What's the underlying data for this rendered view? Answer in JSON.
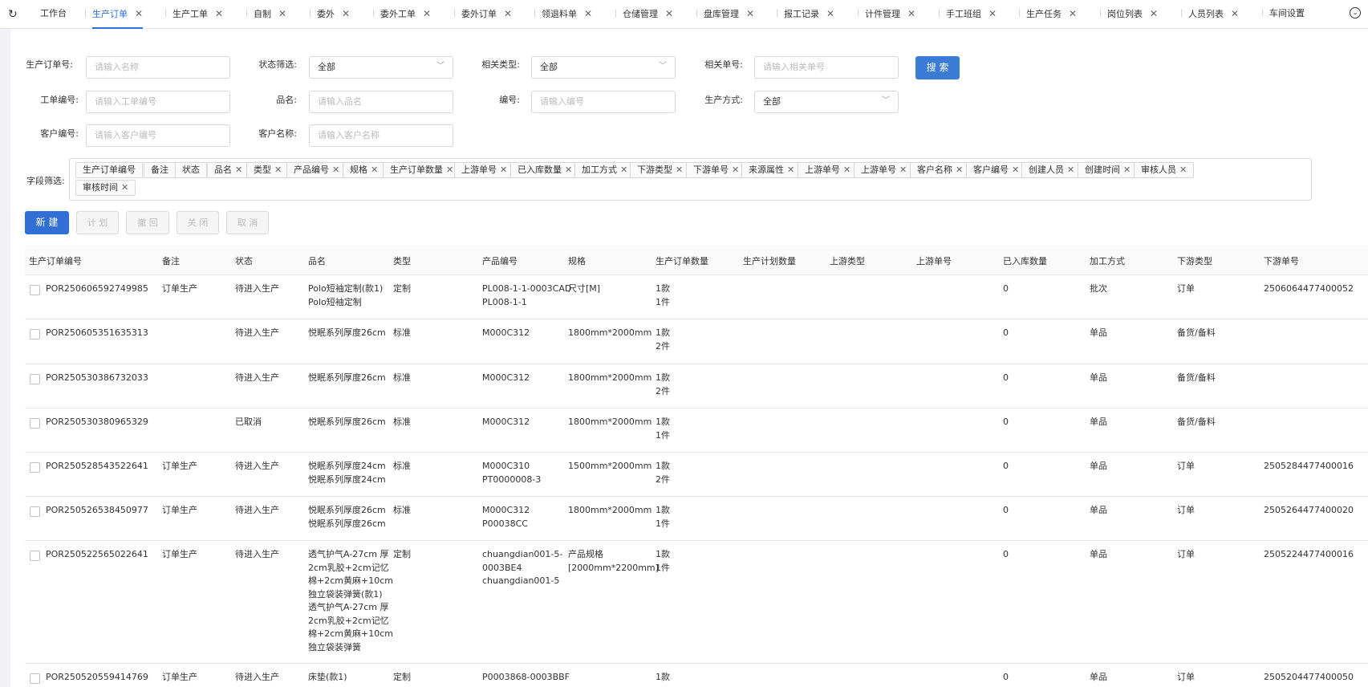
{
  "tabbar": {
    "refresh_icon": "↻",
    "more_icon": "⌄",
    "tabs": [
      {
        "label": "工作台",
        "closable": false
      },
      {
        "label": "生产订单",
        "closable": true,
        "active": true
      },
      {
        "label": "生产工单",
        "closable": true
      },
      {
        "label": "自制",
        "closable": true
      },
      {
        "label": "委外",
        "closable": true
      },
      {
        "label": "委外工单",
        "closable": true
      },
      {
        "label": "委外订单",
        "closable": true
      },
      {
        "label": "领退料单",
        "closable": true
      },
      {
        "label": "仓储管理",
        "closable": true
      },
      {
        "label": "盘库管理",
        "closable": true
      },
      {
        "label": "报工记录",
        "closable": true
      },
      {
        "label": "计件管理",
        "closable": true
      },
      {
        "label": "手工班组",
        "closable": true
      },
      {
        "label": "生产任务",
        "closable": true
      },
      {
        "label": "岗位列表",
        "closable": true
      },
      {
        "label": "人员列表",
        "closable": true
      },
      {
        "label": "车间设置",
        "closable": false
      }
    ]
  },
  "filters": {
    "order_no": {
      "label": "生产订单号:",
      "placeholder": "请输入名称"
    },
    "status": {
      "label": "状态筛选:",
      "value": "全部"
    },
    "related_type": {
      "label": "相关类型:",
      "value": "全部"
    },
    "related_no": {
      "label": "相关单号:",
      "placeholder": "请输入相关单号"
    },
    "search_button": "搜 索",
    "work_order_no": {
      "label": "工单编号:",
      "placeholder": "请输入工单编号"
    },
    "product_name": {
      "label": "品名:",
      "placeholder": "请输入品名"
    },
    "code": {
      "label": "编号:",
      "placeholder": "请输入编号"
    },
    "production_mode": {
      "label": "生产方式:",
      "value": "全部"
    },
    "customer_no": {
      "label": "客户编号:",
      "placeholder": "请输入客户编号"
    },
    "customer_name": {
      "label": "客户名称:",
      "placeholder": "请输入客户名称"
    }
  },
  "field_filter": {
    "label": "字段筛选:",
    "chips": [
      {
        "label": "生产订单编号",
        "removable": false
      },
      {
        "label": "备注",
        "removable": false
      },
      {
        "label": "状态",
        "removable": false
      },
      {
        "label": "品名",
        "removable": true
      },
      {
        "label": "类型",
        "removable": true
      },
      {
        "label": "产品编号",
        "removable": true
      },
      {
        "label": "规格",
        "removable": true
      },
      {
        "label": "生产订单数量",
        "removable": true
      },
      {
        "label": "上游单号",
        "removable": true
      },
      {
        "label": "已入库数量",
        "removable": true
      },
      {
        "label": "加工方式",
        "removable": true
      },
      {
        "label": "下游类型",
        "removable": true
      },
      {
        "label": "下游单号",
        "removable": true
      },
      {
        "label": "来源属性",
        "removable": true
      },
      {
        "label": "上游单号",
        "removable": true
      },
      {
        "label": "上游单号",
        "removable": true
      },
      {
        "label": "客户名称",
        "removable": true
      },
      {
        "label": "客户编号",
        "removable": true
      },
      {
        "label": "创建人员",
        "removable": true
      },
      {
        "label": "创建时间",
        "removable": true
      },
      {
        "label": "审核人员",
        "removable": true
      },
      {
        "label": "审核时间",
        "removable": true
      }
    ]
  },
  "actions": {
    "new": "新 建",
    "plan": "计 划",
    "revoke": "撤 回",
    "close": "关 闭",
    "cancel": "取 消"
  },
  "table": {
    "columns": [
      "生产订单编号",
      "备注",
      "状态",
      "品名",
      "类型",
      "产品编号",
      "规格",
      "生产订单数量",
      "生产计划数量",
      "上游类型",
      "上游单号",
      "已入库数量",
      "加工方式",
      "下游类型",
      "下游单号"
    ],
    "rows": [
      {
        "order_no": "POR250606592749985",
        "remark": "订单生产",
        "status": "待进入生产",
        "name_lines": [
          "Polo短袖定制(款1)",
          "Polo短袖定制"
        ],
        "type": "定制",
        "code_lines": [
          "PL008-1-1-0003CAD",
          "PL008-1-1"
        ],
        "spec_lines": [
          "尺寸[M]"
        ],
        "qty_lines": [
          "1款",
          "1件"
        ],
        "plan_qty": "",
        "up_type": "",
        "up_no": "",
        "stocked": "0",
        "process": "批次",
        "down_type": "订单",
        "down_no": "2506064477400052"
      },
      {
        "order_no": "POR250605351635313",
        "remark": "",
        "status": "待进入生产",
        "name_lines": [
          "悦眠系列厚度26cm"
        ],
        "type": "标准",
        "code_lines": [
          "M000C312"
        ],
        "spec_lines": [
          "1800mm*2000mm"
        ],
        "qty_lines": [
          "1款",
          "2件"
        ],
        "plan_qty": "",
        "up_type": "",
        "up_no": "",
        "stocked": "0",
        "process": "单品",
        "down_type": "备货/备料",
        "down_no": ""
      },
      {
        "order_no": "POR250530386732033",
        "remark": "",
        "status": "待进入生产",
        "name_lines": [
          "悦眠系列厚度26cm"
        ],
        "type": "标准",
        "code_lines": [
          "M000C312"
        ],
        "spec_lines": [
          "1800mm*2000mm"
        ],
        "qty_lines": [
          "1款",
          "2件"
        ],
        "plan_qty": "",
        "up_type": "",
        "up_no": "",
        "stocked": "0",
        "process": "单品",
        "down_type": "备货/备料",
        "down_no": ""
      },
      {
        "order_no": "POR250530380965329",
        "remark": "",
        "status": "已取消",
        "name_lines": [
          "悦眠系列厚度26cm"
        ],
        "type": "标准",
        "code_lines": [
          "M000C312"
        ],
        "spec_lines": [
          "1800mm*2000mm"
        ],
        "qty_lines": [
          "1款",
          "1件"
        ],
        "plan_qty": "",
        "up_type": "",
        "up_no": "",
        "stocked": "0",
        "process": "单品",
        "down_type": "备货/备料",
        "down_no": ""
      },
      {
        "order_no": "POR250528543522641",
        "remark": "订单生产",
        "status": "待进入生产",
        "name_lines": [
          "悦眠系列厚度24cm",
          "悦眠系列厚度24cm"
        ],
        "type": "标准",
        "code_lines": [
          "M000C310",
          "PT0000008-3"
        ],
        "spec_lines": [
          "1500mm*2000mm"
        ],
        "qty_lines": [
          "1款",
          "2件"
        ],
        "plan_qty": "",
        "up_type": "",
        "up_no": "",
        "stocked": "0",
        "process": "单品",
        "down_type": "订单",
        "down_no": "2505284477400016"
      },
      {
        "order_no": "POR250526538450977",
        "remark": "订单生产",
        "status": "待进入生产",
        "name_lines": [
          "悦眠系列厚度26cm",
          "悦眠系列厚度26cm"
        ],
        "type": "标准",
        "code_lines": [
          "M000C312",
          "P00038CC"
        ],
        "spec_lines": [
          "1800mm*2000mm"
        ],
        "qty_lines": [
          "1款",
          "1件"
        ],
        "plan_qty": "",
        "up_type": "",
        "up_no": "",
        "stocked": "0",
        "process": "单品",
        "down_type": "订单",
        "down_no": "2505264477400020"
      },
      {
        "order_no": "POR250522565022641",
        "remark": "订单生产",
        "status": "待进入生产",
        "name_lines": [
          "透气护气A-27cm 厚",
          "2cm乳胶+2cm记忆",
          "棉+2cm黄麻+10cm",
          "独立袋装弹簧(款1)",
          "透气护气A-27cm 厚",
          "2cm乳胶+2cm记忆",
          "棉+2cm黄麻+10cm",
          "独立袋装弹簧"
        ],
        "type": "定制",
        "code_lines": [
          "chuangdian001-5-",
          "0003BE4",
          "chuangdian001-5"
        ],
        "spec_lines": [
          "产品规格",
          "[2000mm*2200mm]"
        ],
        "qty_lines": [
          "1款",
          "1件"
        ],
        "plan_qty": "",
        "up_type": "",
        "up_no": "",
        "stocked": "0",
        "process": "单品",
        "down_type": "订单",
        "down_no": "2505224477400016"
      },
      {
        "order_no": "POR250520559414769",
        "remark": "订单生产",
        "status": "待进入生产",
        "name_lines": [
          "床垫(款1)"
        ],
        "type": "定制",
        "code_lines": [
          "P0003868-0003BBF"
        ],
        "spec_lines": [],
        "qty_lines": [
          "1款"
        ],
        "plan_qty": "",
        "up_type": "",
        "up_no": "",
        "stocked": "0",
        "process": "单品",
        "down_type": "订单",
        "down_no": "2505204477400050"
      }
    ]
  }
}
